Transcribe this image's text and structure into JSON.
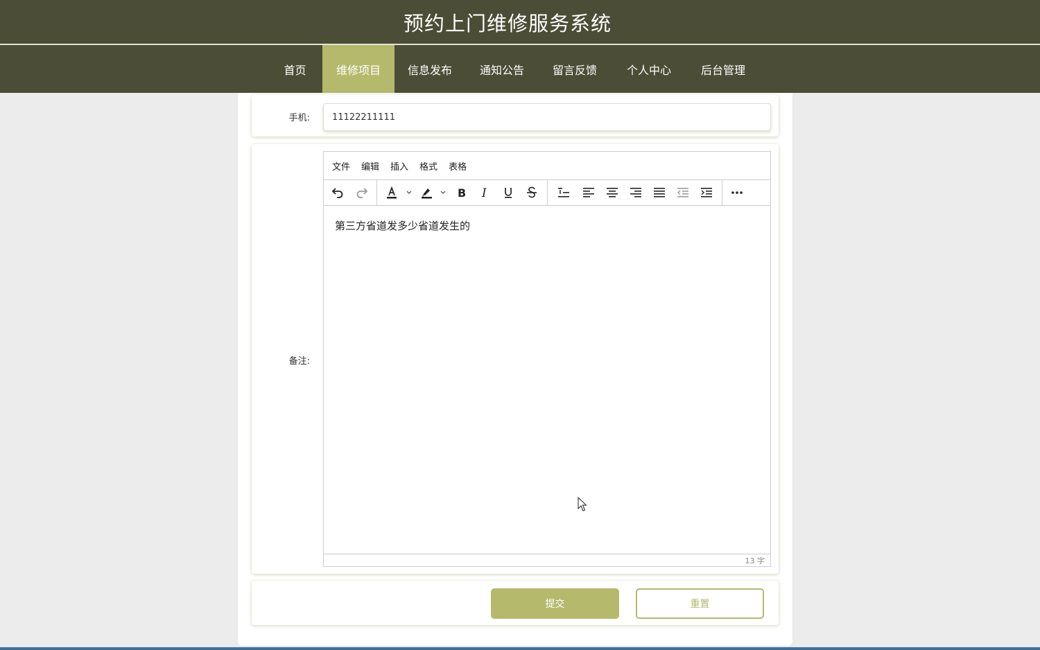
{
  "header": {
    "title": "预约上门维修服务系统"
  },
  "nav": {
    "items": [
      {
        "label": "首页"
      },
      {
        "label": "维修项目"
      },
      {
        "label": "信息发布"
      },
      {
        "label": "通知公告"
      },
      {
        "label": "留言反馈"
      },
      {
        "label": "个人中心"
      },
      {
        "label": "后台管理"
      }
    ],
    "active_index": 1
  },
  "form": {
    "phone": {
      "label": "手机:",
      "value": "11122211111"
    },
    "remark": {
      "label": "备注:",
      "menubar": [
        "文件",
        "编辑",
        "插入",
        "格式",
        "表格"
      ],
      "toolbar_icons": [
        "undo-icon",
        "redo-icon",
        "text-color-icon",
        "highlight-color-icon",
        "bold-icon",
        "italic-icon",
        "underline-icon",
        "strikethrough-icon",
        "line-height-icon",
        "align-left-icon",
        "align-center-icon",
        "align-right-icon",
        "align-justify-icon",
        "outdent-icon",
        "indent-icon",
        "more-icon"
      ],
      "content": "第三方省道发多少省道发生的",
      "word_count": "13 字"
    },
    "submit_label": "提交",
    "reset_label": "重置"
  },
  "colors": {
    "header_bg": "#4c4d36",
    "accent": "#b5b96c",
    "page_bg": "#ececec"
  }
}
